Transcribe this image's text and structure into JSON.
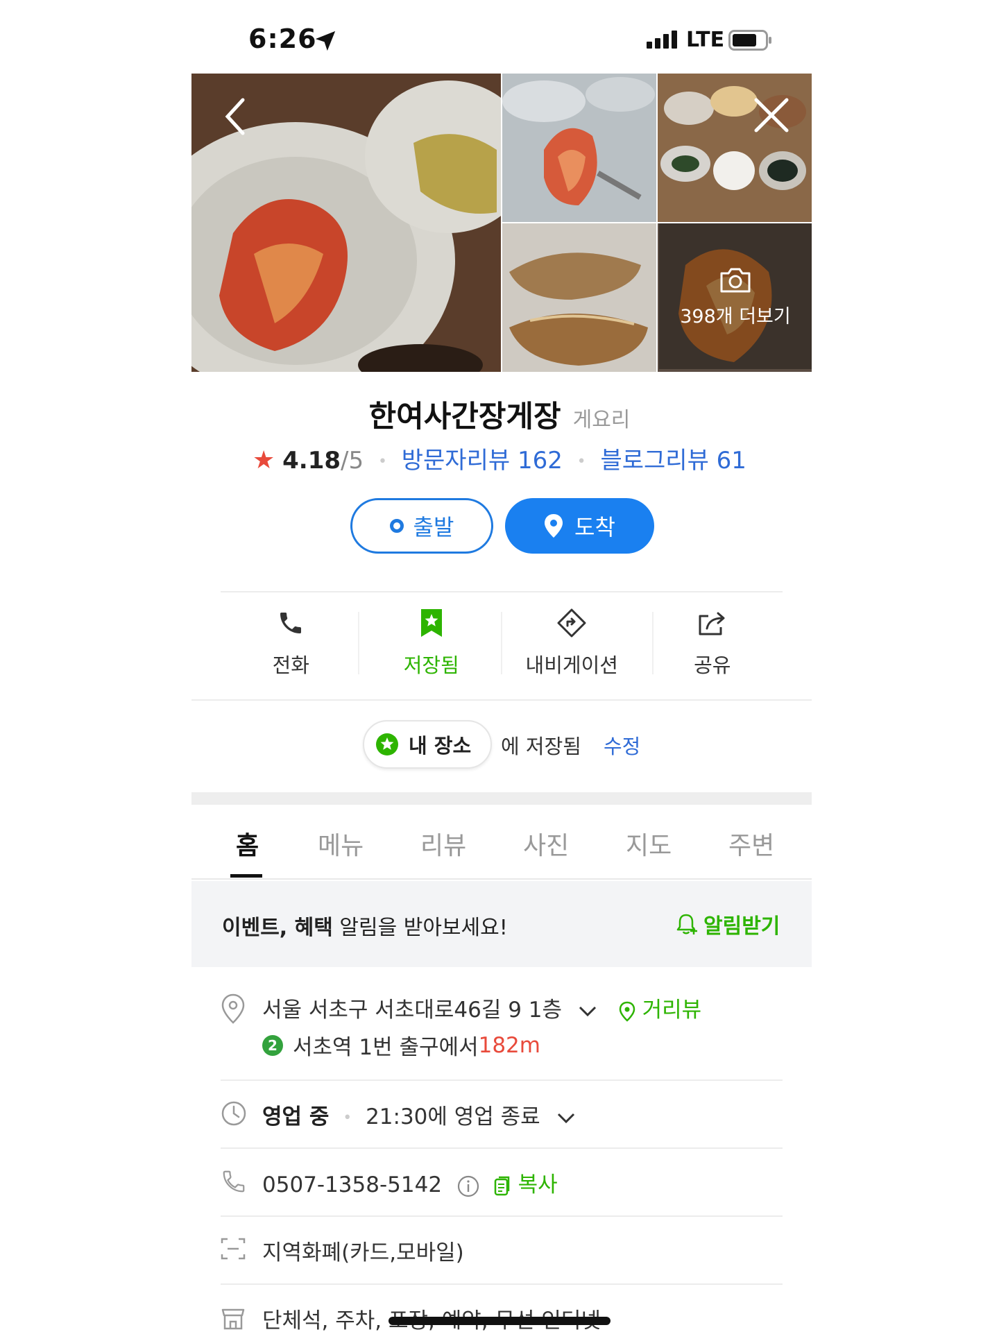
{
  "status_bar": {
    "time": "6:26",
    "network": "LTE"
  },
  "photos": {
    "more_label": "398개 더보기"
  },
  "place": {
    "name": "한여사간장게장",
    "category": "게요리",
    "rating": "4.18",
    "rating_max": "/5",
    "visitor_reviews": "방문자리뷰 162",
    "blog_reviews": "블로그리뷰 61"
  },
  "route": {
    "depart_label": "출발",
    "arrive_label": "도착"
  },
  "actions": [
    {
      "label": "전화",
      "icon": "phone-icon"
    },
    {
      "label": "저장됨",
      "icon": "bookmark-star-icon"
    },
    {
      "label": "내비게이션",
      "icon": "navigation-icon"
    },
    {
      "label": "공유",
      "icon": "share-icon"
    }
  ],
  "saved": {
    "place_list": "내 장소",
    "saved_text": "에 저장됨",
    "edit_label": "수정"
  },
  "tabs": [
    "홈",
    "메뉴",
    "리뷰",
    "사진",
    "지도",
    "주변"
  ],
  "active_tab": "홈",
  "alert": {
    "bold1": "이벤트, 혜택",
    "rest": " 알림을 받아보세요!",
    "button": "알림받기"
  },
  "info": {
    "address": "서울 서초구 서초대로46길 9 1층",
    "streetview": "거리뷰",
    "subway_line": "2",
    "subway_text": "서초역 1번 출구에서 ",
    "subway_distance": "182m",
    "open_status": "영업 중",
    "hours": "21:30에 영업 종료",
    "phone": "0507-1358-5142",
    "copy_label": "복사",
    "payment": "지역화폐(카드,모바일)",
    "amenities": "단체석, 주차, 포장, 예약, 무선 인터넷"
  },
  "colors": {
    "accent_blue": "#1a80f0",
    "link_blue": "#2f6bd6",
    "green": "#2db400",
    "star_red": "#e84a3b",
    "subway_line2": "#33a23d"
  }
}
